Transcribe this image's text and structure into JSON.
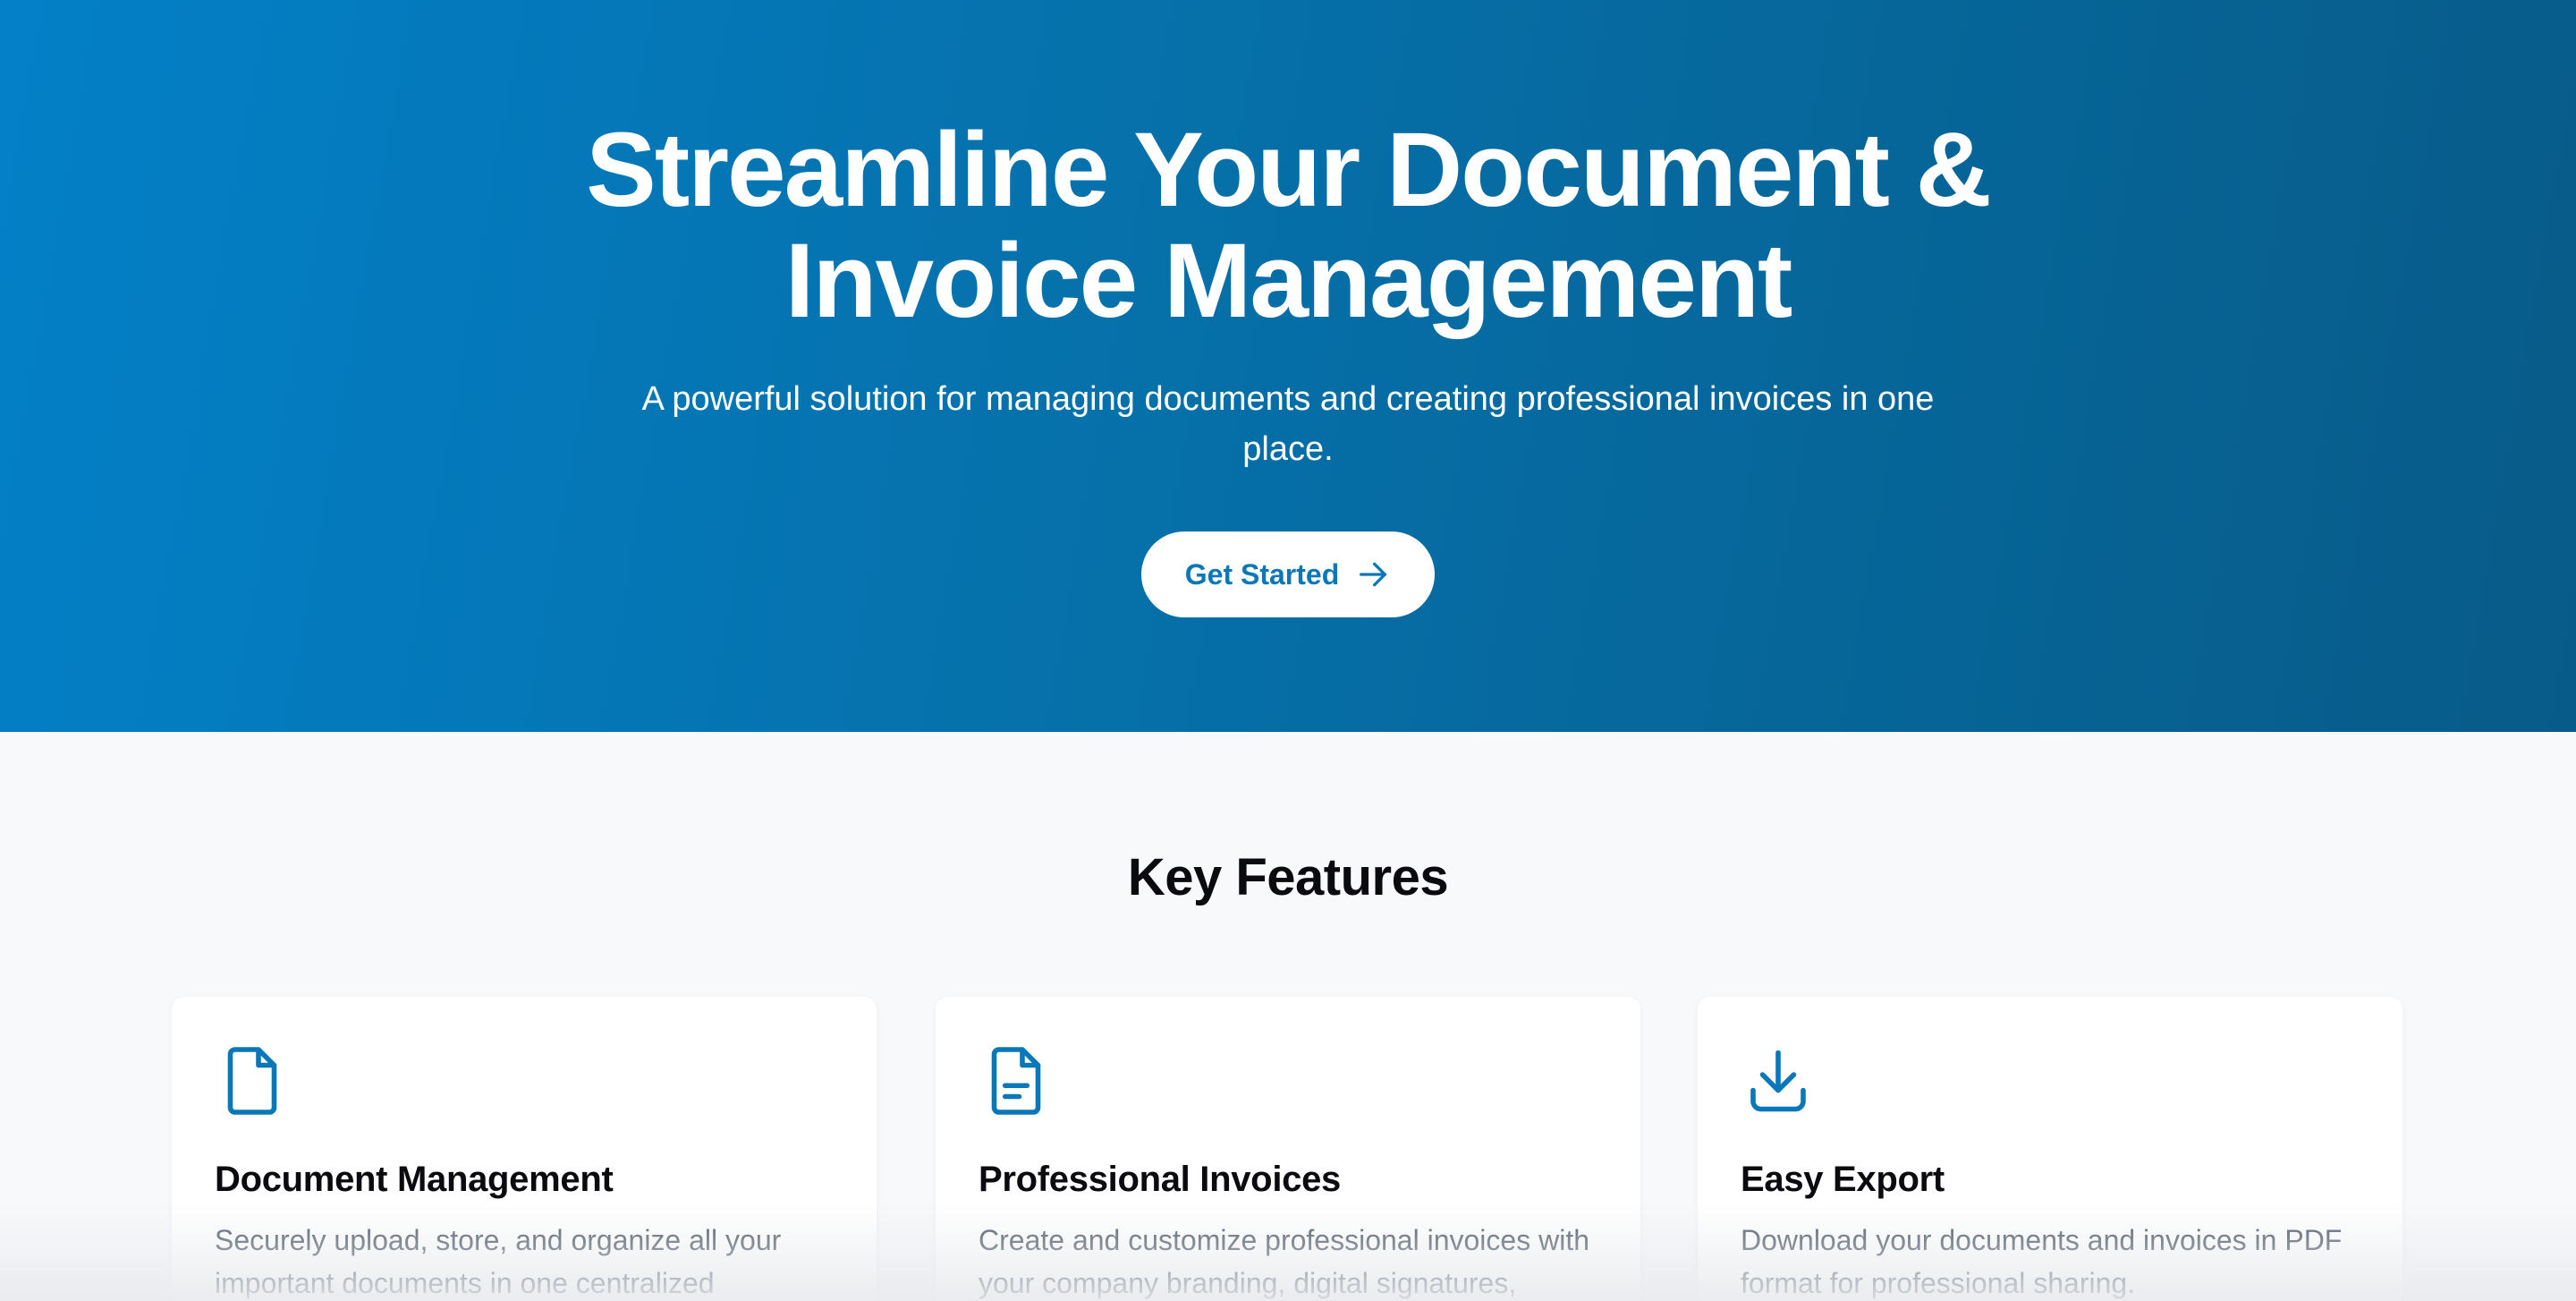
{
  "hero": {
    "title": "Streamline Your Document & Invoice Management",
    "subtitle": "A powerful solution for managing documents and creating professional invoices in one place.",
    "cta_label": "Get Started",
    "cta_icon": "arrow-right-icon"
  },
  "features": {
    "title": "Key Features",
    "cards": [
      {
        "icon": "document-icon",
        "title": "Document Management",
        "description": "Securely upload, store, and organize all your important documents in one centralized"
      },
      {
        "icon": "invoice-icon",
        "title": "Professional Invoices",
        "description": "Create and customize professional invoices with your company branding, digital signatures,"
      },
      {
        "icon": "download-icon",
        "title": "Easy Export",
        "description": "Download your documents and invoices in PDF format for professional sharing."
      }
    ]
  },
  "colors": {
    "hero_gradient_start": "#0380c8",
    "hero_gradient_end": "#075b88",
    "accent": "#0a78b8",
    "background": "#f8f9fb",
    "card": "#ffffff",
    "heading": "#0b0b0f",
    "body_text": "#4a5563"
  }
}
